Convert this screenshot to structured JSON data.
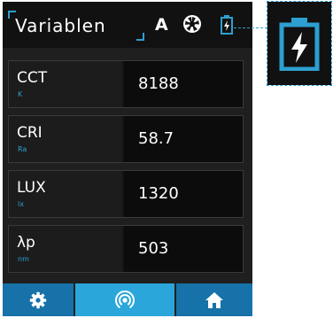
{
  "header": {
    "title": "Variablen",
    "mode_label": "A",
    "aperture_icon": "aperture-icon",
    "battery_icon": "battery-charging-icon"
  },
  "measurements": [
    {
      "name": "CCT",
      "unit": "K",
      "value": "8188"
    },
    {
      "name": "CRI",
      "unit": "Ra",
      "value": "58.7"
    },
    {
      "name": "LUX",
      "unit": "lx",
      "value": "1320"
    },
    {
      "name": "λp",
      "unit": "nm",
      "value": "503"
    }
  ],
  "nav": {
    "items": [
      {
        "icon": "gear-icon",
        "active": false
      },
      {
        "icon": "signal-icon",
        "active": true
      },
      {
        "icon": "home-icon",
        "active": false
      }
    ]
  },
  "callout": {
    "icon": "battery-charging-icon"
  },
  "colors": {
    "accent": "#2d9fd0",
    "nav_active": "#2aa6da",
    "nav_inactive": "#1672a8",
    "background": "#1f1f1f"
  }
}
